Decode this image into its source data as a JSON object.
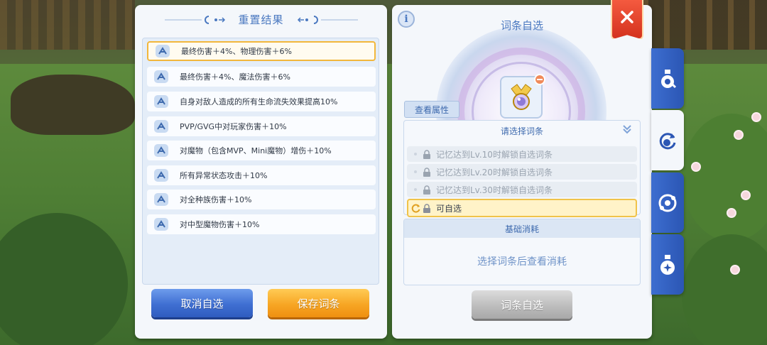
{
  "left_panel": {
    "title": "重置结果",
    "results": [
      {
        "text": "最终伤害＋4%、物理伤害＋6%",
        "selected": true
      },
      {
        "text": "最终伤害＋4%、魔法伤害＋6%",
        "selected": false
      },
      {
        "text": "自身对敌人造成的所有生命流失效果提高10%",
        "selected": false
      },
      {
        "text": "PVP/GVG中对玩家伤害＋10%",
        "selected": false
      },
      {
        "text": "对魔物（包含MVP、Mini魔物）增伤＋10%",
        "selected": false
      },
      {
        "text": "所有异常状态攻击＋10%",
        "selected": false
      },
      {
        "text": "对全种族伤害＋10%",
        "selected": false
      },
      {
        "text": "对中型魔物伤害＋10%",
        "selected": false
      }
    ],
    "cancel_label": "取消自选",
    "save_label": "保存词条"
  },
  "right_panel": {
    "info_icon_label": "i",
    "title": "词条自选",
    "view_attr_label": "查看属性",
    "select_header": "请选择词条",
    "options": [
      {
        "text": "记忆达到Lv.10时解锁自选词条",
        "locked": true
      },
      {
        "text": "记忆达到Lv.20时解锁自选词条",
        "locked": true
      },
      {
        "text": "记忆达到Lv.30时解锁自选词条",
        "locked": true
      },
      {
        "text": "可自选",
        "locked": false
      }
    ],
    "cost_header": "基础消耗",
    "cost_placeholder": "选择词条后查看消耗",
    "select_button_label": "词条自选"
  },
  "side_tabs": [
    {
      "icon": "potion-icon",
      "active": false
    },
    {
      "icon": "refresh-gear-icon",
      "active": true
    },
    {
      "icon": "orb-icon",
      "active": false
    },
    {
      "icon": "sparkle-potion-icon",
      "active": false
    }
  ],
  "colors": {
    "accent_blue": "#4a78c0",
    "selected_border": "#f2b73c",
    "close_red": "#d4321e",
    "tab_blue": "#2b56b4"
  }
}
